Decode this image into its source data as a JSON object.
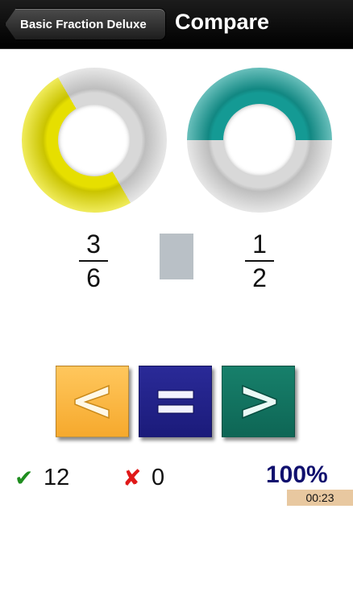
{
  "navbar": {
    "back_label": "Basic Fraction Deluxe",
    "title": "Compare"
  },
  "fractions": {
    "left": {
      "numerator": "3",
      "denominator": "6",
      "color": "#e6df00"
    },
    "right": {
      "numerator": "1",
      "denominator": "2",
      "color": "#149a94"
    }
  },
  "buttons": {
    "less": {
      "icon": "less-than-icon"
    },
    "equal": {
      "icon": "equals-icon"
    },
    "greater": {
      "icon": "greater-than-icon"
    }
  },
  "score": {
    "correct": "12",
    "wrong": "0",
    "percent": "100%",
    "timer": "00:23"
  },
  "colors": {
    "correct": "#1f8d1f",
    "wrong": "#e01818",
    "percent": "#10106e"
  }
}
